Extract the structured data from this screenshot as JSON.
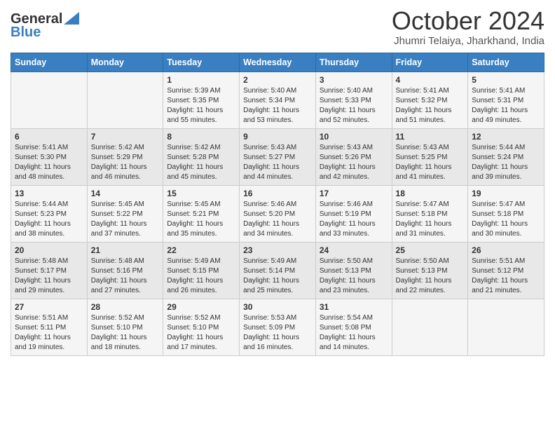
{
  "logo": {
    "general": "General",
    "blue": "Blue"
  },
  "title": "October 2024",
  "subtitle": "Jhumri Telaiya, Jharkhand, India",
  "days_of_week": [
    "Sunday",
    "Monday",
    "Tuesday",
    "Wednesday",
    "Thursday",
    "Friday",
    "Saturday"
  ],
  "weeks": [
    [
      {
        "day": "",
        "sunrise": "",
        "sunset": "",
        "daylight": ""
      },
      {
        "day": "",
        "sunrise": "",
        "sunset": "",
        "daylight": ""
      },
      {
        "day": "1",
        "sunrise": "Sunrise: 5:39 AM",
        "sunset": "Sunset: 5:35 PM",
        "daylight": "Daylight: 11 hours and 55 minutes."
      },
      {
        "day": "2",
        "sunrise": "Sunrise: 5:40 AM",
        "sunset": "Sunset: 5:34 PM",
        "daylight": "Daylight: 11 hours and 53 minutes."
      },
      {
        "day": "3",
        "sunrise": "Sunrise: 5:40 AM",
        "sunset": "Sunset: 5:33 PM",
        "daylight": "Daylight: 11 hours and 52 minutes."
      },
      {
        "day": "4",
        "sunrise": "Sunrise: 5:41 AM",
        "sunset": "Sunset: 5:32 PM",
        "daylight": "Daylight: 11 hours and 51 minutes."
      },
      {
        "day": "5",
        "sunrise": "Sunrise: 5:41 AM",
        "sunset": "Sunset: 5:31 PM",
        "daylight": "Daylight: 11 hours and 49 minutes."
      }
    ],
    [
      {
        "day": "6",
        "sunrise": "Sunrise: 5:41 AM",
        "sunset": "Sunset: 5:30 PM",
        "daylight": "Daylight: 11 hours and 48 minutes."
      },
      {
        "day": "7",
        "sunrise": "Sunrise: 5:42 AM",
        "sunset": "Sunset: 5:29 PM",
        "daylight": "Daylight: 11 hours and 46 minutes."
      },
      {
        "day": "8",
        "sunrise": "Sunrise: 5:42 AM",
        "sunset": "Sunset: 5:28 PM",
        "daylight": "Daylight: 11 hours and 45 minutes."
      },
      {
        "day": "9",
        "sunrise": "Sunrise: 5:43 AM",
        "sunset": "Sunset: 5:27 PM",
        "daylight": "Daylight: 11 hours and 44 minutes."
      },
      {
        "day": "10",
        "sunrise": "Sunrise: 5:43 AM",
        "sunset": "Sunset: 5:26 PM",
        "daylight": "Daylight: 11 hours and 42 minutes."
      },
      {
        "day": "11",
        "sunrise": "Sunrise: 5:43 AM",
        "sunset": "Sunset: 5:25 PM",
        "daylight": "Daylight: 11 hours and 41 minutes."
      },
      {
        "day": "12",
        "sunrise": "Sunrise: 5:44 AM",
        "sunset": "Sunset: 5:24 PM",
        "daylight": "Daylight: 11 hours and 39 minutes."
      }
    ],
    [
      {
        "day": "13",
        "sunrise": "Sunrise: 5:44 AM",
        "sunset": "Sunset: 5:23 PM",
        "daylight": "Daylight: 11 hours and 38 minutes."
      },
      {
        "day": "14",
        "sunrise": "Sunrise: 5:45 AM",
        "sunset": "Sunset: 5:22 PM",
        "daylight": "Daylight: 11 hours and 37 minutes."
      },
      {
        "day": "15",
        "sunrise": "Sunrise: 5:45 AM",
        "sunset": "Sunset: 5:21 PM",
        "daylight": "Daylight: 11 hours and 35 minutes."
      },
      {
        "day": "16",
        "sunrise": "Sunrise: 5:46 AM",
        "sunset": "Sunset: 5:20 PM",
        "daylight": "Daylight: 11 hours and 34 minutes."
      },
      {
        "day": "17",
        "sunrise": "Sunrise: 5:46 AM",
        "sunset": "Sunset: 5:19 PM",
        "daylight": "Daylight: 11 hours and 33 minutes."
      },
      {
        "day": "18",
        "sunrise": "Sunrise: 5:47 AM",
        "sunset": "Sunset: 5:18 PM",
        "daylight": "Daylight: 11 hours and 31 minutes."
      },
      {
        "day": "19",
        "sunrise": "Sunrise: 5:47 AM",
        "sunset": "Sunset: 5:18 PM",
        "daylight": "Daylight: 11 hours and 30 minutes."
      }
    ],
    [
      {
        "day": "20",
        "sunrise": "Sunrise: 5:48 AM",
        "sunset": "Sunset: 5:17 PM",
        "daylight": "Daylight: 11 hours and 29 minutes."
      },
      {
        "day": "21",
        "sunrise": "Sunrise: 5:48 AM",
        "sunset": "Sunset: 5:16 PM",
        "daylight": "Daylight: 11 hours and 27 minutes."
      },
      {
        "day": "22",
        "sunrise": "Sunrise: 5:49 AM",
        "sunset": "Sunset: 5:15 PM",
        "daylight": "Daylight: 11 hours and 26 minutes."
      },
      {
        "day": "23",
        "sunrise": "Sunrise: 5:49 AM",
        "sunset": "Sunset: 5:14 PM",
        "daylight": "Daylight: 11 hours and 25 minutes."
      },
      {
        "day": "24",
        "sunrise": "Sunrise: 5:50 AM",
        "sunset": "Sunset: 5:13 PM",
        "daylight": "Daylight: 11 hours and 23 minutes."
      },
      {
        "day": "25",
        "sunrise": "Sunrise: 5:50 AM",
        "sunset": "Sunset: 5:13 PM",
        "daylight": "Daylight: 11 hours and 22 minutes."
      },
      {
        "day": "26",
        "sunrise": "Sunrise: 5:51 AM",
        "sunset": "Sunset: 5:12 PM",
        "daylight": "Daylight: 11 hours and 21 minutes."
      }
    ],
    [
      {
        "day": "27",
        "sunrise": "Sunrise: 5:51 AM",
        "sunset": "Sunset: 5:11 PM",
        "daylight": "Daylight: 11 hours and 19 minutes."
      },
      {
        "day": "28",
        "sunrise": "Sunrise: 5:52 AM",
        "sunset": "Sunset: 5:10 PM",
        "daylight": "Daylight: 11 hours and 18 minutes."
      },
      {
        "day": "29",
        "sunrise": "Sunrise: 5:52 AM",
        "sunset": "Sunset: 5:10 PM",
        "daylight": "Daylight: 11 hours and 17 minutes."
      },
      {
        "day": "30",
        "sunrise": "Sunrise: 5:53 AM",
        "sunset": "Sunset: 5:09 PM",
        "daylight": "Daylight: 11 hours and 16 minutes."
      },
      {
        "day": "31",
        "sunrise": "Sunrise: 5:54 AM",
        "sunset": "Sunset: 5:08 PM",
        "daylight": "Daylight: 11 hours and 14 minutes."
      },
      {
        "day": "",
        "sunrise": "",
        "sunset": "",
        "daylight": ""
      },
      {
        "day": "",
        "sunrise": "",
        "sunset": "",
        "daylight": ""
      }
    ]
  ]
}
